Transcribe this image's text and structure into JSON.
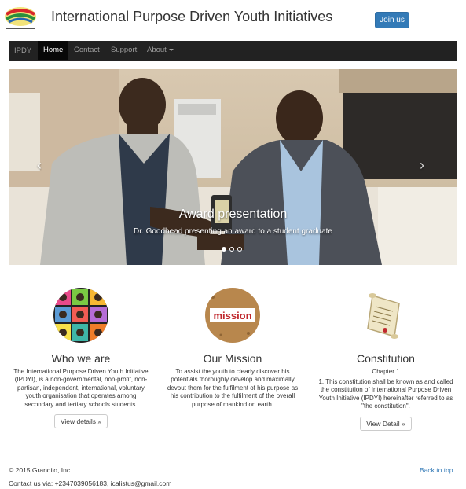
{
  "header": {
    "site_title": "International Purpose Driven Youth Initiatives",
    "join_label": "Join us"
  },
  "navbar": {
    "brand": "IPDY",
    "items": [
      {
        "label": "Home",
        "active": true
      },
      {
        "label": "Contact"
      },
      {
        "label": "Support"
      },
      {
        "label": "About"
      }
    ]
  },
  "carousel": {
    "caption_title": "Award presentation",
    "caption_text": "Dr. Goodhead presenting an award to a student graduate",
    "prev_icon": "chevron-left-icon",
    "next_icon": "chevron-right-icon",
    "slide_count": 3,
    "active_slide": 1
  },
  "features": [
    {
      "heading": "Who we are",
      "text": "The International Purpose Driven Youth Initiative (IPDYI), is a non-governmental, non-profit, non-partisan, independent, international, voluntary youth organisation that operates among secondary and tertiary schools students.",
      "button": "View details »"
    },
    {
      "heading": "Our Mission",
      "text": "To assist the youth to clearly discover his potentials thoroughly develop and maximally devout them for the fulfilment of his purpose as his contribution to the fulfilment of the overall purpose of mankind on earth."
    },
    {
      "heading": "Constitution",
      "subheading": "Chapter 1",
      "text": "1. This constitution shall be known as and called the constitution of International Purpose Driven Youth Initiative (IPDYI) hereinafter referred to as \"the constitution\".",
      "button": "View Detail »"
    }
  ],
  "mission_image_text": "mission",
  "footer": {
    "copyright": "© 2015 Grandilo, Inc.",
    "contact": "Contact us via: +2347039056183, icalistus@gmail.com",
    "back_to_top": "Back to top"
  },
  "colors": {
    "primary": "#337ab7",
    "navbar_bg": "#222222"
  }
}
